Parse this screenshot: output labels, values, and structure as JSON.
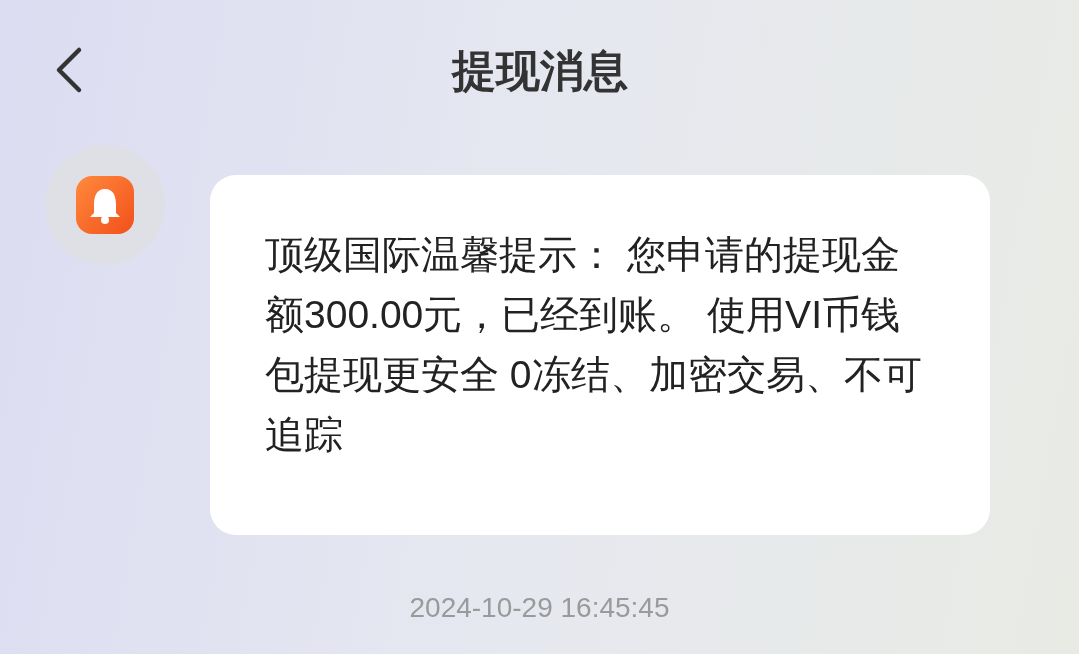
{
  "header": {
    "title": "提现消息"
  },
  "messages": [
    {
      "text": "顶级国际温馨提示： 您申请的提现金额300.00元，已经到账。 使用VI币钱包提现更安全 0冻结、加密交易、不可追踪",
      "time": "2024-10-29 16:45:45"
    }
  ]
}
